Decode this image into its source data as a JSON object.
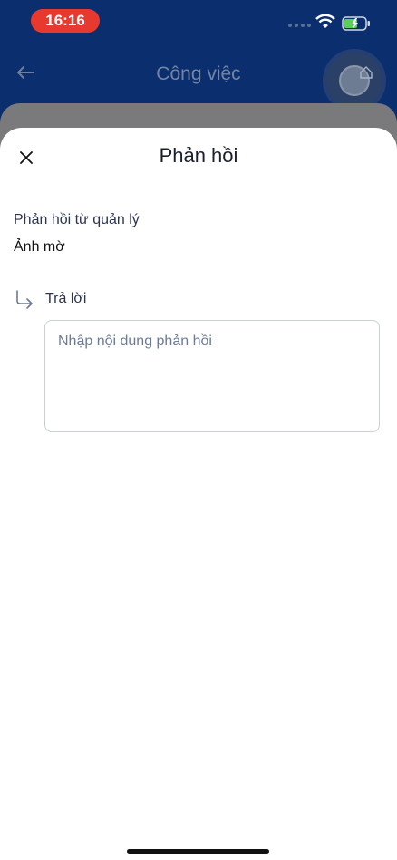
{
  "status_bar": {
    "time": "16:16"
  },
  "header": {
    "back_icon": "arrow-left-icon",
    "title": "Công việc",
    "home_icon": "home-icon"
  },
  "sheet": {
    "close_icon": "close-icon",
    "title": "Phản hồi",
    "feedback_label": "Phản hồi từ quản lý",
    "feedback_text": "Ảnh mờ",
    "reply_icon": "reply-arrow-icon",
    "reply_label": "Trả lời",
    "reply_input": {
      "value": "",
      "placeholder": "Nhập nội dung phản hồi"
    }
  },
  "colors": {
    "header_bg": "#0b2f6e",
    "time_pill": "#e8392f",
    "battery": "#5ad05a"
  }
}
